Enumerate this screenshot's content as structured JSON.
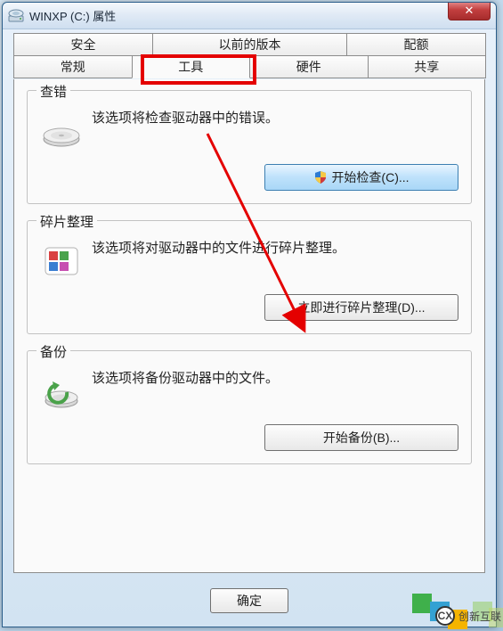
{
  "window": {
    "title": "WINXP (C:) 属性",
    "close_label": "✕"
  },
  "tabs_row1": [
    {
      "label": "安全",
      "active": false
    },
    {
      "label": "以前的版本",
      "active": false
    },
    {
      "label": "配额",
      "active": false
    }
  ],
  "tabs_row2": [
    {
      "label": "常规",
      "active": false
    },
    {
      "label": "工具",
      "active": true
    },
    {
      "label": "硬件",
      "active": false
    },
    {
      "label": "共享",
      "active": false
    }
  ],
  "groups": {
    "checkerror": {
      "title": "查错",
      "desc": "该选项将检查驱动器中的错误。",
      "button": "开始检查(C)..."
    },
    "defrag": {
      "title": "碎片整理",
      "desc": "该选项将对驱动器中的文件进行碎片整理。",
      "button": "立即进行碎片整理(D)..."
    },
    "backup": {
      "title": "备份",
      "desc": "该选项将备份驱动器中的文件。",
      "button": "开始备份(B)..."
    }
  },
  "dialog_buttons": {
    "ok": "确定"
  },
  "watermark": {
    "brand": "创新互联",
    "mark": "CX"
  }
}
